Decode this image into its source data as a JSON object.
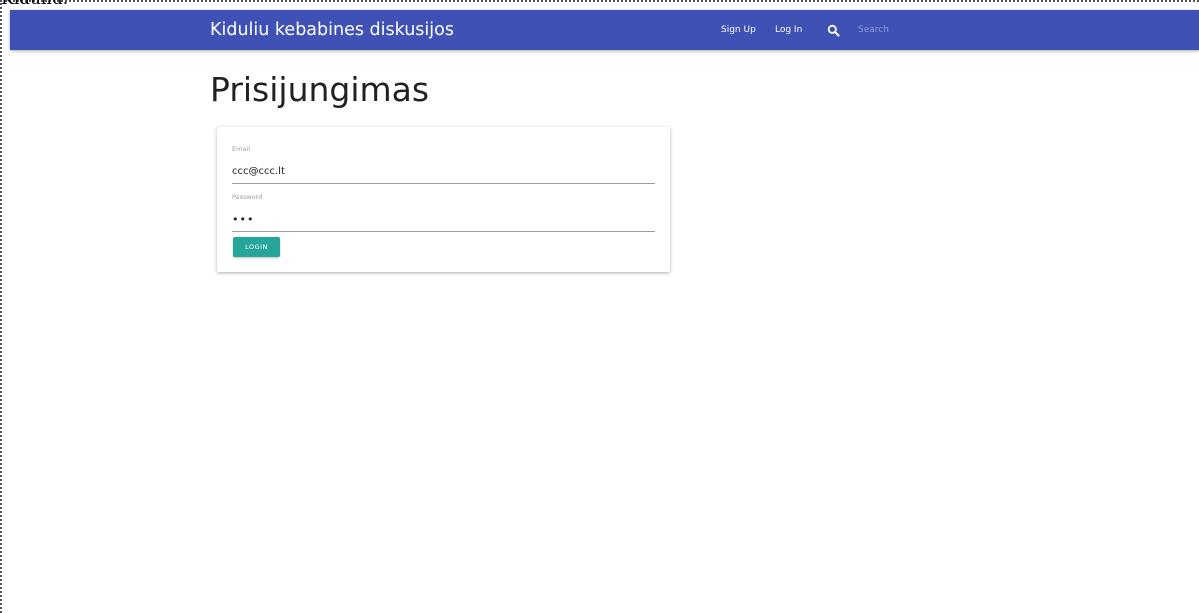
{
  "top_fragment": "Kiduliu.",
  "navbar": {
    "brand": "Kiduliu kebabines diskusijos",
    "links": {
      "signup": "Sign Up",
      "login": "Log In"
    },
    "search": {
      "icon": "search-icon",
      "placeholder": "Search",
      "value": ""
    }
  },
  "page": {
    "title": "Prisijungimas"
  },
  "form": {
    "email": {
      "label": "Email",
      "value": "ccc@ccc.lt"
    },
    "password": {
      "label": "Password",
      "value": "•••"
    },
    "submit_label": "LOGIN"
  },
  "colors": {
    "navbar": "#3f51b5",
    "button": "#26a69a",
    "page_background": "#ffffff"
  }
}
